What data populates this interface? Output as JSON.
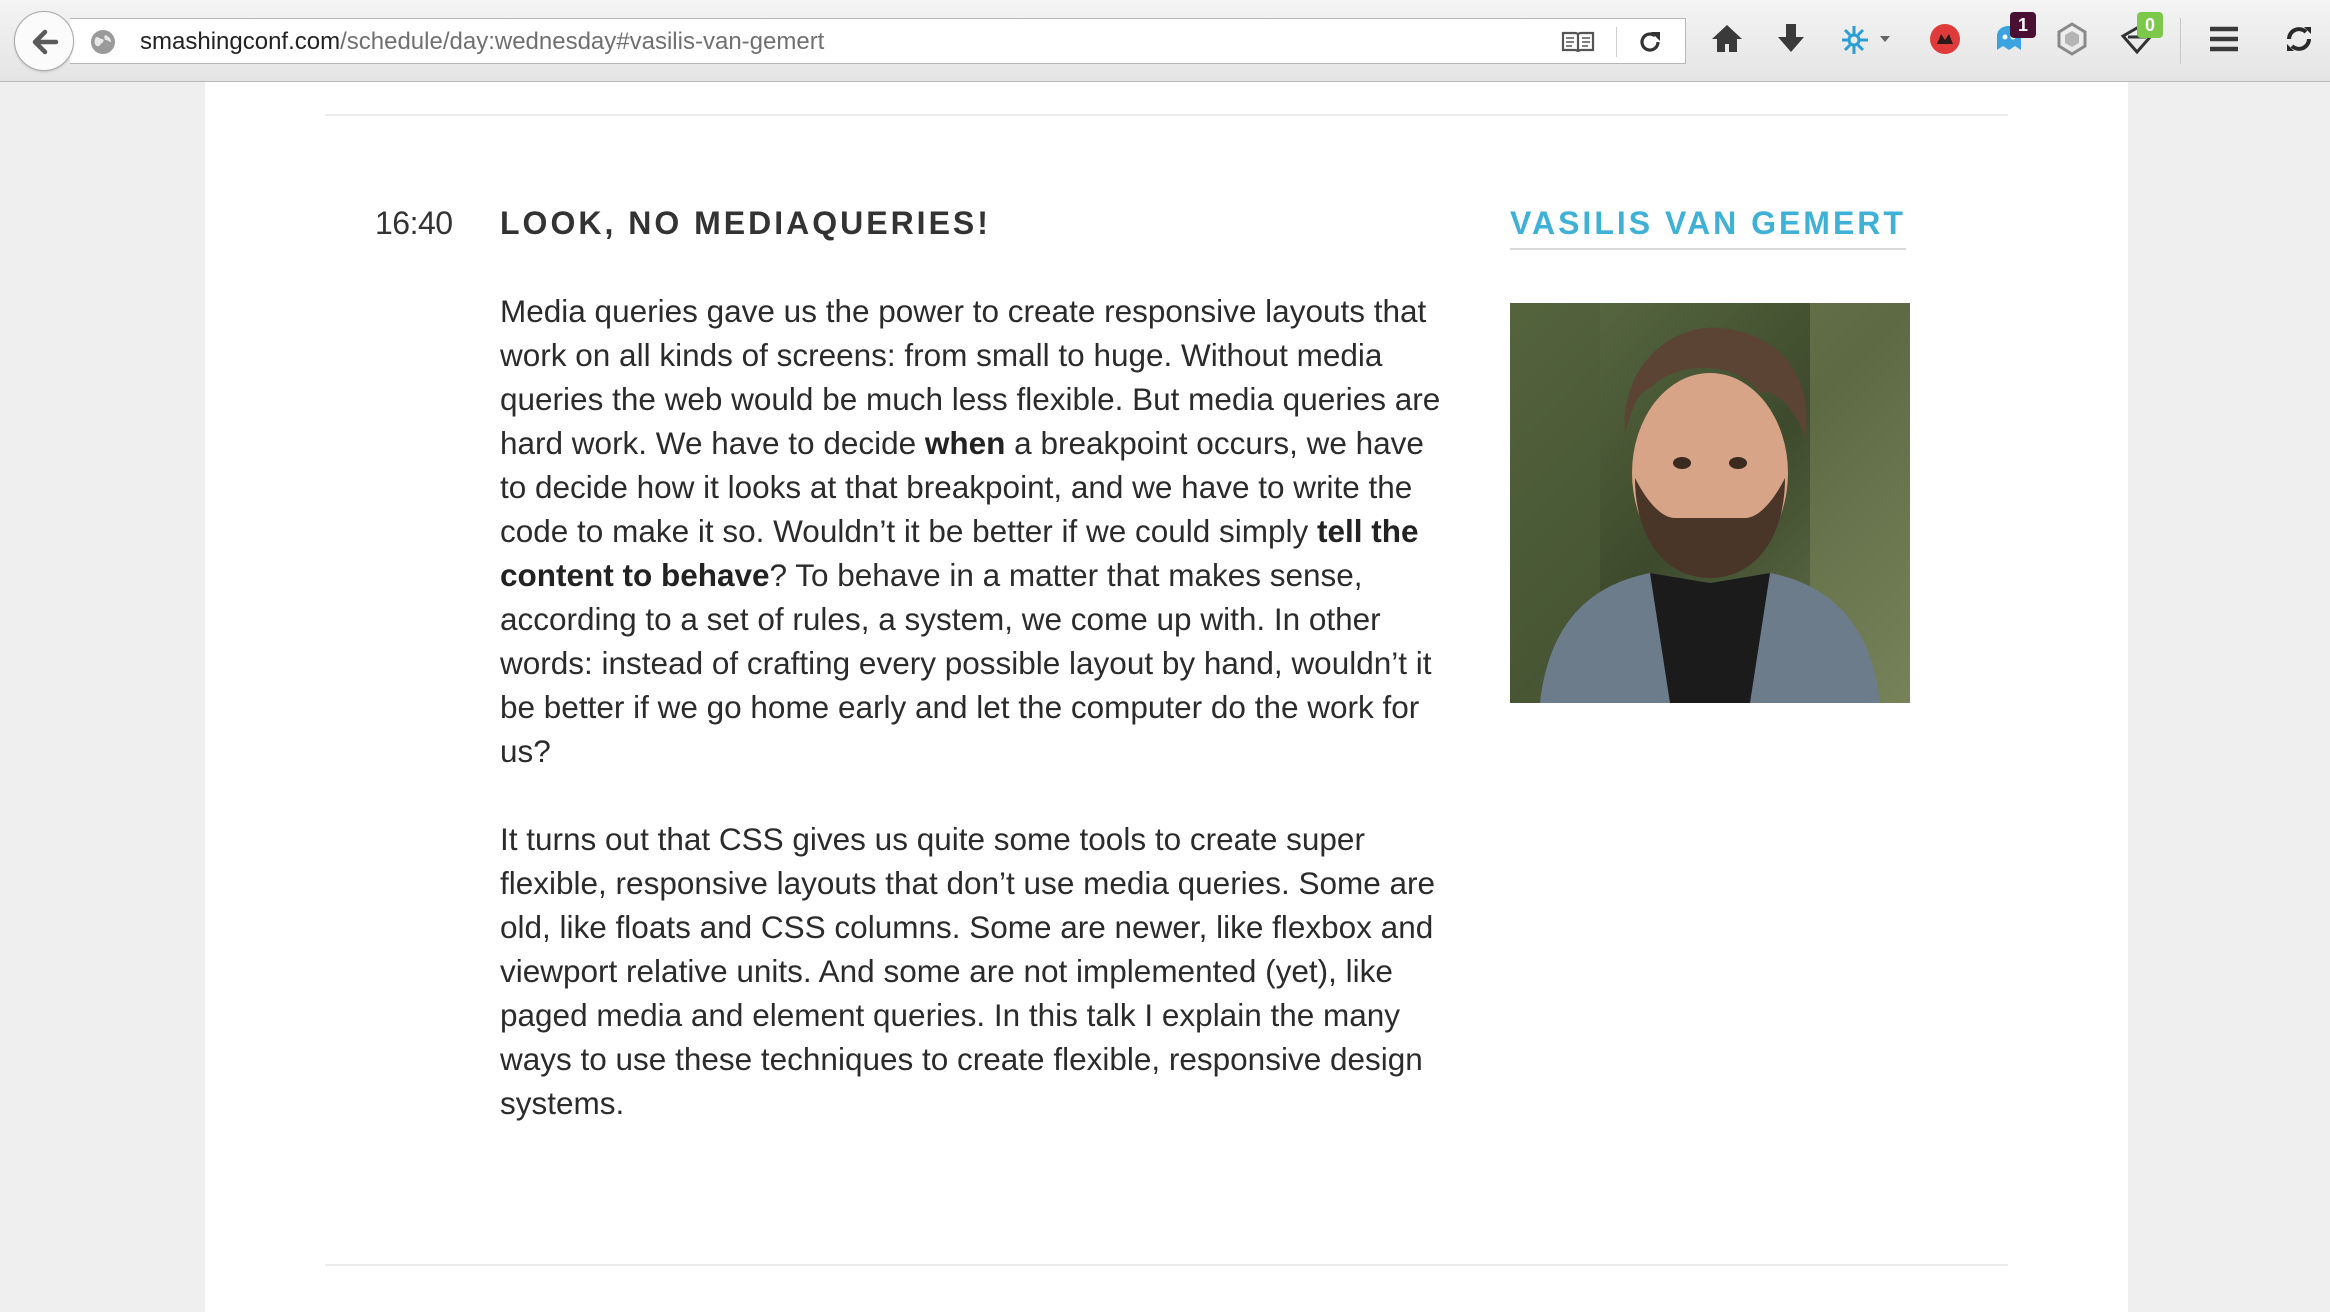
{
  "browser": {
    "url_host": "smashingconf.com",
    "url_path": "/schedule/day:wednesday#vasilis-van-gemert",
    "badges": {
      "tweetdeck_count": "1",
      "extension_count": "0"
    },
    "colors": {
      "badge_dark": "#4a1034",
      "badge_green": "#7cc84a"
    }
  },
  "talk": {
    "time": "16:40",
    "title": "LOOK, NO MEDIAQUERIES!",
    "speaker": "VASILIS VAN GEMERT",
    "description": {
      "p1": {
        "s1": "Media queries gave us the power to create responsive layouts that work on all kinds of screens: from small to huge. Without media queries the web would be much less flexible. But media queries are hard work. We have to decide ",
        "b1": "when",
        "s2": " a breakpoint occurs, we have to decide how it looks at that breakpoint, and we have to write the code to make it so. Wouldn’t it be better if we could simply ",
        "b2": "tell the content to behave",
        "s3": "? To behave in a matter that makes sense, according to a set of rules, a system, we come up with. In other words: instead of crafting every possible layout by hand, wouldn’t it be better if we go home early and let the computer do the work for us?"
      },
      "p2": "It turns out that CSS gives us quite some tools to create super flexible, responsive layouts that don’t use media queries. Some are old, like floats and CSS columns. Some are newer, like flexbox and viewport relative units. And some are not implemented (yet), like paged media and element queries. In this talk I explain the many ways to use these techniques to create flexible, responsive design systems."
    },
    "colors": {
      "speaker": "#3fb0d6",
      "text": "#2b2b2b"
    }
  }
}
